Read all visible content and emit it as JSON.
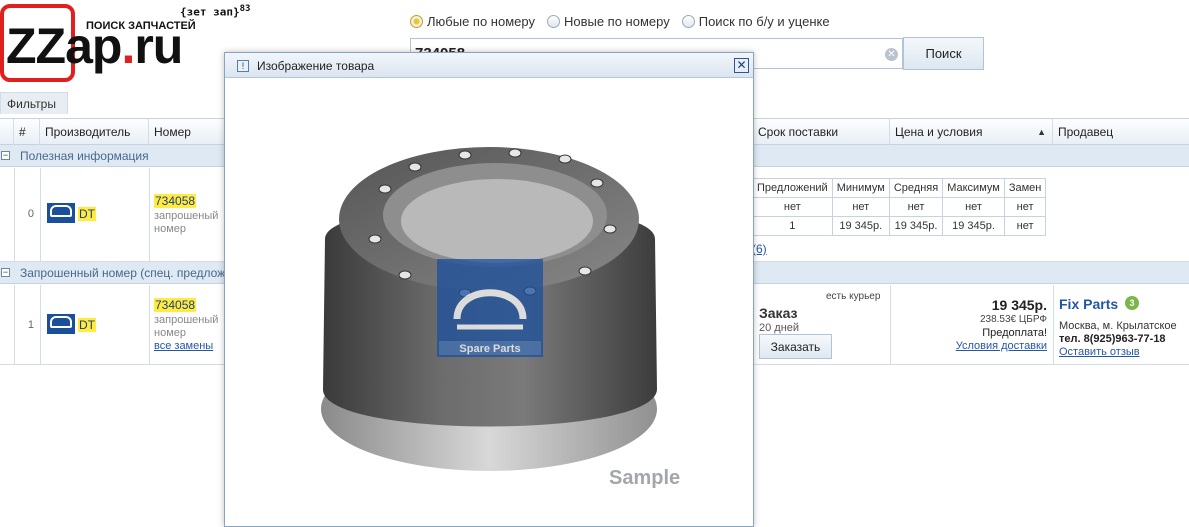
{
  "logo": {
    "text_main": "ZZap",
    "text_dot": ".",
    "text_tld": "ru",
    "tagline": "ПОИСК ЗАПЧАСТЕЙ",
    "zet": "{зет зап}",
    "zet_sup": "83"
  },
  "search": {
    "options": [
      {
        "label": "Любые по номеру",
        "selected": true
      },
      {
        "label": "Новые по номеру",
        "selected": false
      },
      {
        "label": "Поиск по б/у и уценке",
        "selected": false
      }
    ],
    "value": "734058",
    "button_label": "Поиск"
  },
  "filters_tab": "Фильтры",
  "table": {
    "headers": {
      "num": "#",
      "manufacturer": "Производитель",
      "number": "Номер",
      "delivery": "Срок поставки",
      "price": "Цена и условия",
      "seller": "Продавец"
    },
    "groups": [
      {
        "label": "Полезная информация"
      },
      {
        "label": "Запрошенный номер (спец. предложения)"
      }
    ],
    "rows": [
      {
        "index": "0",
        "manufacturer": "DT",
        "part_number": "734058",
        "note_line1": "запрошеный",
        "note_line2": "номер"
      },
      {
        "index": "1",
        "manufacturer": "DT",
        "part_number": "734058",
        "note_line1": "запрошеный",
        "note_line2": "номер",
        "replacements_link": "все замены"
      }
    ],
    "stats": {
      "headers": [
        "Предложений",
        "Минимум",
        "Средняя",
        "Максимум",
        "Замен"
      ],
      "rows": [
        [
          "нет",
          "нет",
          "нет",
          "нет",
          "нет"
        ],
        [
          "1",
          "19 345р.",
          "19 345р.",
          "19 345р.",
          "нет"
        ]
      ],
      "more_link": "(6)"
    },
    "offer": {
      "order_title": "Заказ",
      "order_days": "20 дней",
      "order_button": "Заказать",
      "courier": "есть курьер",
      "price": "19 345р.",
      "price_eur": "238.53€ ЦБРФ",
      "prepay": "Предоплата!",
      "delivery_link": "Условия доставки",
      "seller_name": "Fix Parts",
      "seller_badge": "3",
      "seller_city": "Москва, м. Крылатское",
      "seller_phone": "тел. 8(925)963-77-18",
      "seller_review": "Оставить отзыв"
    }
  },
  "modal": {
    "title": "Изображение товара",
    "close_icon": "close-icon",
    "sample_label": "Sample",
    "watermark": "Spare Parts"
  },
  "colors": {
    "brand_red": "#e0201e",
    "link_blue": "#2456a8",
    "highlight_yellow": "#ffec3d",
    "header_bg": "#dfe9f4"
  }
}
